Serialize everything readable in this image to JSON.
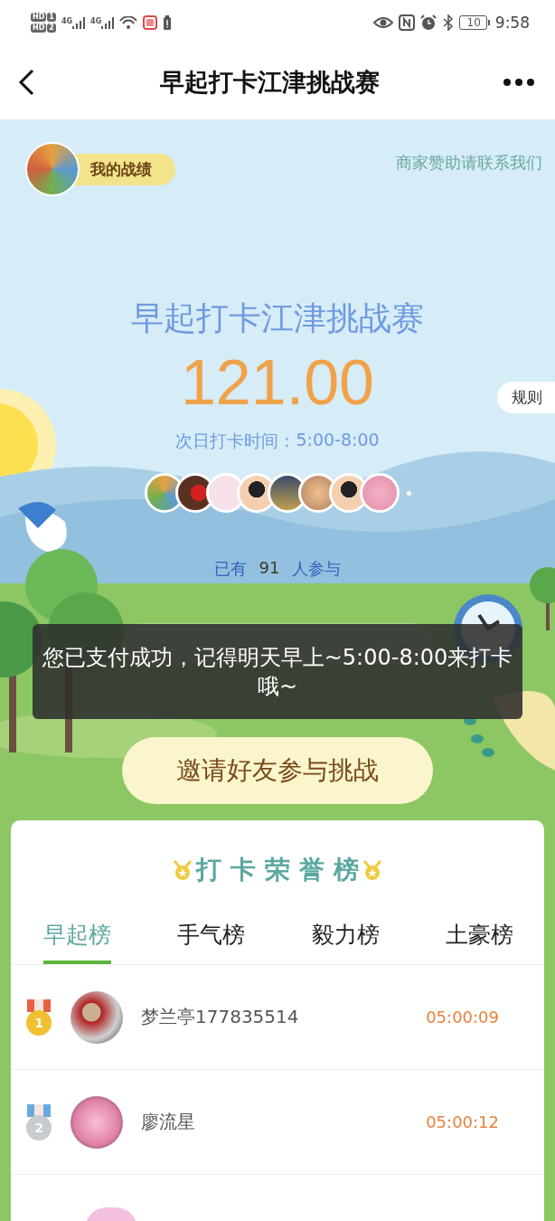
{
  "status_bar": {
    "sims": [
      {
        "badge": "HD",
        "slot": "1"
      },
      {
        "badge": "HD",
        "slot": "2"
      }
    ],
    "networks": [
      "4G",
      "4G"
    ],
    "battery": "10",
    "time": "9:58"
  },
  "header": {
    "title": "早起打卡江津挑战赛"
  },
  "hero": {
    "my_record": "我的战绩",
    "sponsor_link": "商家赞助请联系我们",
    "title": "早起打卡江津挑战赛",
    "amount": "121.00",
    "rules_button": "规则",
    "schedule_label": "次日打卡时间：",
    "schedule_time": "5:00-8:00",
    "participants": {
      "prefix": "已有",
      "count": "91",
      "suffix": "人参与"
    },
    "invite_button": "邀请好友参与挑战"
  },
  "toast": {
    "message": "您已支付成功，记得明天早上~5:00-8:00来打卡哦~"
  },
  "leaderboard": {
    "title": "打卡荣誉榜",
    "tabs": [
      {
        "label": "早起榜",
        "selected": true
      },
      {
        "label": "手气榜",
        "selected": false
      },
      {
        "label": "毅力榜",
        "selected": false
      },
      {
        "label": "土豪榜",
        "selected": false
      }
    ],
    "rows": [
      {
        "kind": "gold",
        "rank": "1",
        "name": "梦兰亭177835514",
        "time": "05:00:09"
      },
      {
        "kind": "silver",
        "rank": "2",
        "name": "廖流星",
        "time": "05:00:12"
      }
    ]
  }
}
